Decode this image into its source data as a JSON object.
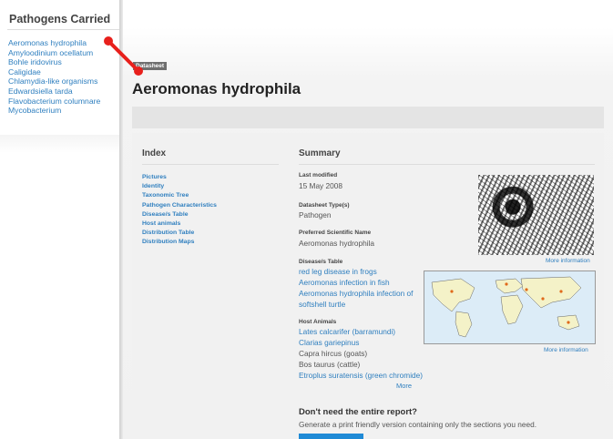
{
  "left_panel": {
    "title": "Pathogens Carried",
    "items": [
      "Aeromonas hydrophila",
      "Amyloodinium ocellatum",
      "Bohle iridovirus",
      "Caligidae",
      "Chlamydia-like organisms",
      "Edwardsiella tarda",
      "Flavobacterium columnare",
      "Mycobacterium"
    ]
  },
  "datasheet": {
    "badge": "Datasheet",
    "title": "Aeromonas hydrophila"
  },
  "index": {
    "title": "Index",
    "items": [
      "Pictures",
      "Identity",
      "Taxonomic Tree",
      "Pathogen Characteristics",
      "Disease/s Table",
      "Host animals",
      "Distribution Table",
      "Distribution Maps"
    ]
  },
  "summary": {
    "title": "Summary",
    "last_modified_label": "Last modified",
    "last_modified_value": "15 May 2008",
    "type_label": "Datasheet Type(s)",
    "type_value": "Pathogen",
    "sci_name_label": "Preferred Scientific Name",
    "sci_name_value": "Aeromonas hydrophila",
    "disease_label": "Disease/s Table",
    "diseases": [
      "red leg disease in frogs",
      "Aeromonas infection in fish",
      "Aeromonas hydrophila infection of",
      "softshell turtle"
    ],
    "host_label": "Host Animals",
    "hosts": [
      {
        "text": "Lates calcarifer (barramundi)",
        "link": true
      },
      {
        "text": "Clarias gariepinus",
        "link": true
      },
      {
        "text": "Capra hircus (goats)",
        "link": false
      },
      {
        "text": "Bos taurus (cattle)",
        "link": false
      },
      {
        "text": "Etroplus suratensis (green chromide)",
        "link": true
      }
    ],
    "more_label": "More",
    "more_info_image": "More information",
    "more_info_map": "More information"
  },
  "report": {
    "title": "Don't need the entire report?",
    "description": "Generate a print friendly version containing only the sections you need."
  },
  "colors": {
    "link": "#2f7fbf",
    "pointer": "#e8201c",
    "button": "#1f8ad6"
  }
}
